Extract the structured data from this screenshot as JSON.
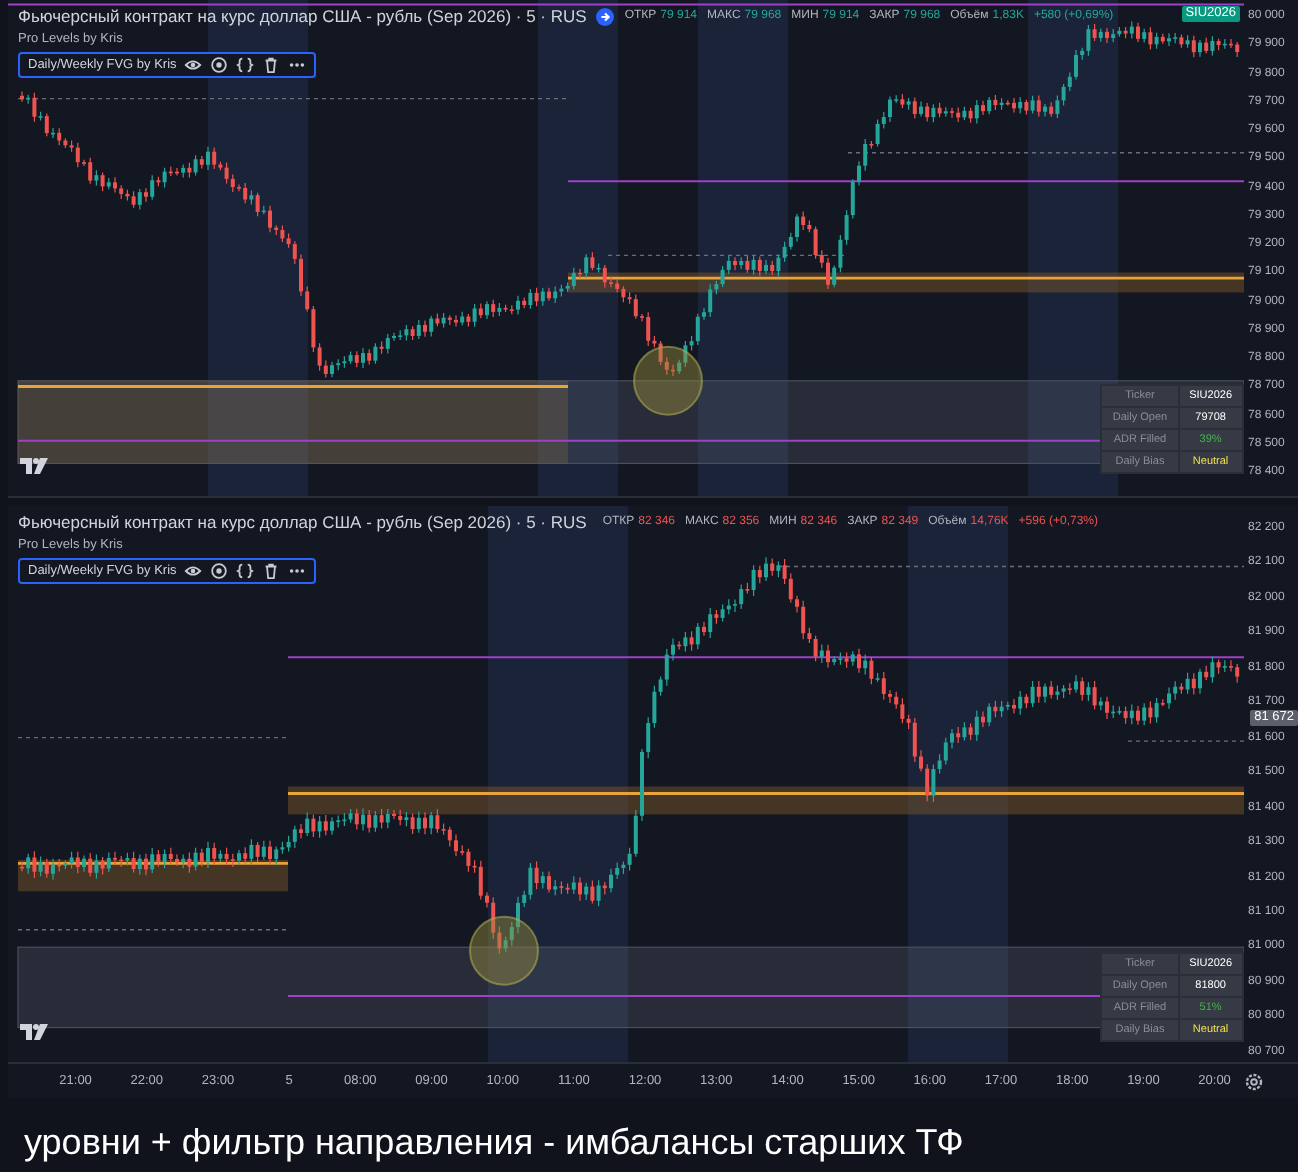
{
  "panels": [
    {
      "title": "Фьючерсный контракт на курс доллар США - рубль (Sep 2026) · 5 · RUS",
      "status_icon": true,
      "ohlc": [
        {
          "label": "ОТКР",
          "value": "79 914",
          "color": "#26a69a"
        },
        {
          "label": "МАКС",
          "value": "79 968",
          "color": "#26a69a"
        },
        {
          "label": "МИН",
          "value": "79 914",
          "color": "#26a69a"
        },
        {
          "label": "ЗАКР",
          "value": "79 968",
          "color": "#26a69a"
        },
        {
          "label": "Объём",
          "value": "1,83K",
          "color": "#26a69a"
        }
      ],
      "change": {
        "text": "+580 (+0,69%)",
        "color": "#26a69a"
      },
      "indicators": [
        {
          "name": "Pro Levels by Kris",
          "kind": "plain"
        },
        {
          "name": "Daily/Weekly FVG by Kris",
          "kind": "toolbar"
        }
      ],
      "price_axis": [
        "80 000",
        "79 900",
        "79 800",
        "79 700",
        "79 600",
        "79 500",
        "79 400",
        "79 300",
        "79 200",
        "79 100",
        "79 000",
        "78 900",
        "78 800",
        "78 700",
        "78 600",
        "78 500",
        "78 400"
      ],
      "price_badge": {
        "text": "SIU2026",
        "color": "#089981"
      },
      "info_table": [
        {
          "label": "Ticker",
          "value": "SIU2026",
          "color": "#ffffff"
        },
        {
          "label": "Daily Open",
          "value": "79708",
          "color": "#ffffff"
        },
        {
          "label": "ADR Filled",
          "value": "39%",
          "color": "#4caf50"
        },
        {
          "label": "Daily Bias",
          "value": "Neutral",
          "color": "#f5e04a"
        }
      ]
    },
    {
      "title": "Фьючерсный контракт на курс доллар США - рубль (Sep 2026) · 5 · RUS",
      "status_icon": false,
      "ohlc": [
        {
          "label": "ОТКР",
          "value": "82 346",
          "color": "#ef5350"
        },
        {
          "label": "МАКС",
          "value": "82 356",
          "color": "#ef5350"
        },
        {
          "label": "МИН",
          "value": "82 346",
          "color": "#ef5350"
        },
        {
          "label": "ЗАКР",
          "value": "82 349",
          "color": "#ef5350"
        },
        {
          "label": "Объём",
          "value": "14,76K",
          "color": "#ef5350"
        }
      ],
      "change": {
        "text": "+596 (+0,73%)",
        "color": "#ef5350"
      },
      "indicators": [
        {
          "name": "Pro Levels by Kris",
          "kind": "plain"
        },
        {
          "name": "Daily/Weekly FVG by Kris",
          "kind": "toolbar"
        }
      ],
      "price_axis": [
        "82 200",
        "82 100",
        "82 000",
        "81 900",
        "81 800",
        "81 700",
        "81 600",
        "81 500",
        "81 400",
        "81 300",
        "81 200",
        "81 100",
        "81 000",
        "80 900",
        "80 800",
        "80 700"
      ],
      "price_badge": {
        "text": "81 672",
        "color": "#5d606b"
      },
      "info_table": [
        {
          "label": "Ticker",
          "value": "SIU2026",
          "color": "#ffffff"
        },
        {
          "label": "Daily Open",
          "value": "81800",
          "color": "#ffffff"
        },
        {
          "label": "ADR Filled",
          "value": "51%",
          "color": "#4caf50"
        },
        {
          "label": "Daily Bias",
          "value": "Neutral",
          "color": "#f5e04a"
        }
      ]
    }
  ],
  "time_axis": [
    "21:00",
    "22:00",
    "23:00",
    "5",
    "08:00",
    "09:00",
    "10:00",
    "11:00",
    "12:00",
    "13:00",
    "14:00",
    "15:00",
    "16:00",
    "17:00",
    "18:00",
    "19:00",
    "20:00"
  ],
  "caption": "уровни + фильтр направления - имбалансы старших ТФ"
}
